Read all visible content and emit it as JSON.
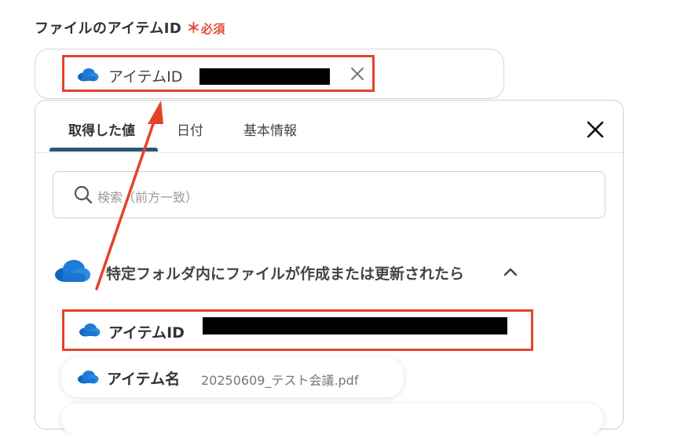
{
  "field": {
    "label": "ファイルのアイテムID",
    "required_mark": "＊",
    "required_text": "必須"
  },
  "chip": {
    "label": "アイテムID",
    "icon": "onedrive-cloud-icon"
  },
  "panel": {
    "tabs": [
      {
        "label": "取得した値",
        "active": true
      },
      {
        "label": "日付",
        "active": false
      },
      {
        "label": "基本情報",
        "active": false
      }
    ],
    "search_placeholder": "検索（前方一致）",
    "group_title": "特定フォルダ内にファイルが作成または更新されたら",
    "items": [
      {
        "label": "アイテムID",
        "value": ""
      },
      {
        "label": "アイテム名",
        "value": "20250609_テスト会議.pdf"
      }
    ]
  },
  "colors": {
    "accent_red": "#e4432b",
    "tab_underline": "#2c5a74",
    "onedrive_blue": "#1f7bd6"
  }
}
